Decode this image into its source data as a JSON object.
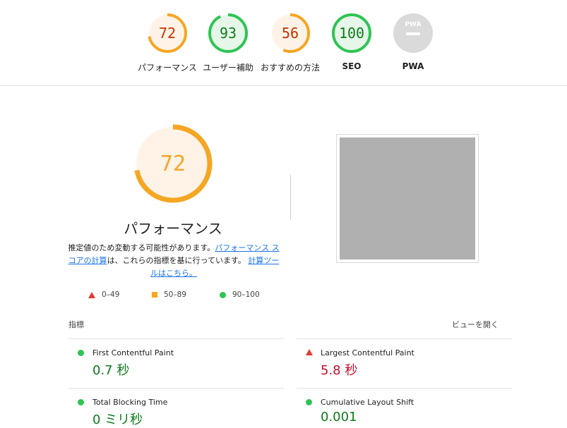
{
  "categories": [
    {
      "score": "72",
      "label": "パフォーマンス",
      "fraction": 0.72,
      "color": "#f5a623",
      "bg": "#fff3e8",
      "text_color": "#c33300"
    },
    {
      "score": "93",
      "label": "ユーザー補助",
      "fraction": 0.93,
      "color": "#2fc453",
      "bg": "#e6f7ea",
      "text_color": "#0c7a1a"
    },
    {
      "score": "56",
      "label": "おすすめの方法",
      "fraction": 0.56,
      "color": "#f5a623",
      "bg": "#fff3e8",
      "text_color": "#c33300"
    },
    {
      "score": "100",
      "label": "SEO",
      "fraction": 1.0,
      "color": "#2fc453",
      "bg": "#e6f7ea",
      "text_color": "#0c7a1a"
    },
    {
      "label": "PWA",
      "badge": "PWA",
      "color": "#dadada"
    }
  ],
  "hero": {
    "score": "72",
    "fraction": 0.72,
    "title": "パフォーマンス",
    "desc_prefix": "推定値のため変動する可能性があります。",
    "link1": "パフォーマンス スコアの計算",
    "desc_mid": "は、これらの指標を基に行っています。",
    "link2": "計算ツールはこちら。"
  },
  "legend": [
    {
      "range": "0–49",
      "shape": "triangle",
      "color": "#e53935"
    },
    {
      "range": "50–89",
      "shape": "square",
      "color": "#f5a623"
    },
    {
      "range": "90–100",
      "shape": "circle",
      "color": "#2fc453"
    }
  ],
  "metrics_header": "指標",
  "view_toggle": "ビューを開く",
  "metrics": [
    {
      "name": "First Contentful Paint",
      "value": "0.7 秒",
      "status": "pass"
    },
    {
      "name": "Largest Contentful Paint",
      "value": "5.8 秒",
      "status": "fail"
    },
    {
      "name": "Total Blocking Time",
      "value": "0 ミリ秒",
      "status": "pass"
    },
    {
      "name": "Cumulative Layout Shift",
      "value": "0.001",
      "status": "pass"
    }
  ]
}
